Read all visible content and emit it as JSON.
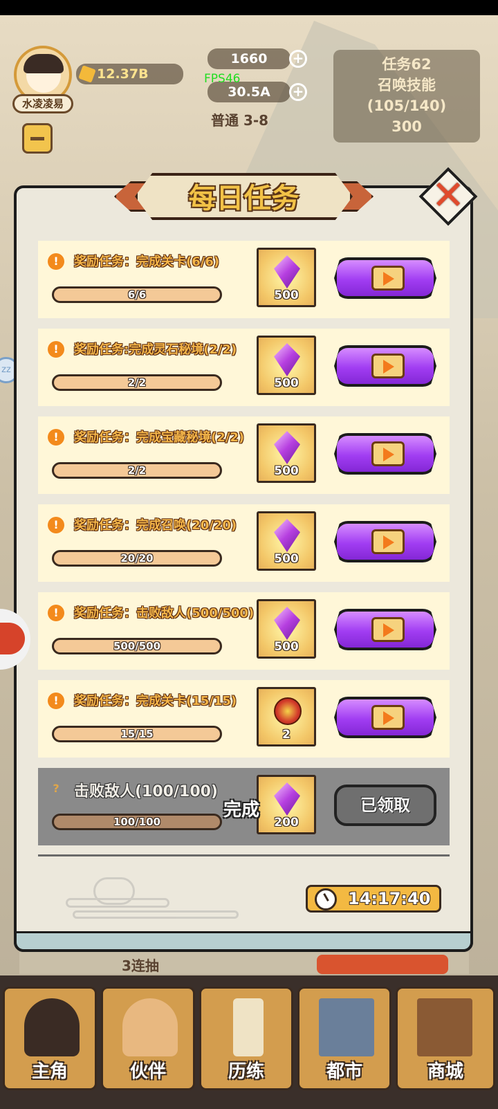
{
  "hud": {
    "player_name": "水凌凌易",
    "gold": "12.37B",
    "gems": "1660",
    "power": "30.5A",
    "fps": "FPS46",
    "stage": "普通 3-8",
    "task_box": {
      "line1": "任务62",
      "line2": "召唤技能",
      "line3": "(105/140)",
      "reward": "300"
    }
  },
  "dialog": {
    "title": "每日任务",
    "close_icon": "close-x-icon",
    "tasks": [
      {
        "title": "奖励任务：完成关卡(6/6)",
        "progress": "6/6",
        "reward_icon": "purple-gem-icon",
        "reward_qty": "500",
        "state": "claim-ad"
      },
      {
        "title": "奖励任务:完成灵石秘境(2/2)",
        "progress": "2/2",
        "reward_icon": "purple-gem-icon",
        "reward_qty": "500",
        "state": "claim-ad"
      },
      {
        "title": "奖励任务：完成宝藏秘境(2/2)",
        "progress": "2/2",
        "reward_icon": "purple-gem-icon",
        "reward_qty": "500",
        "state": "claim-ad"
      },
      {
        "title": "奖励任务：完成召唤(20/20)",
        "progress": "20/20",
        "reward_icon": "purple-gem-icon",
        "reward_qty": "500",
        "state": "claim-ad"
      },
      {
        "title": "奖励任务：击败敌人(500/500)",
        "progress": "500/500",
        "reward_icon": "purple-gem-icon",
        "reward_qty": "500",
        "state": "claim-ad"
      },
      {
        "title": "奖励任务：完成关卡(15/15)",
        "progress": "15/15",
        "reward_icon": "red-coin-icon",
        "reward_qty": "2",
        "state": "claim-ad"
      },
      {
        "title": "击败敌人(100/100)",
        "progress": "100/100",
        "reward_icon": "purple-gem-icon",
        "reward_qty": "200",
        "state": "claimed",
        "done_label": "完成",
        "claimed_label": "已领取"
      }
    ],
    "timer": "14:17:40"
  },
  "peek": {
    "combo": "3连抽"
  },
  "nav": {
    "tabs": [
      {
        "label": "主角"
      },
      {
        "label": "伙伴"
      },
      {
        "label": "历练"
      },
      {
        "label": "都市"
      },
      {
        "label": "商城"
      }
    ]
  },
  "colors": {
    "accent_purple": "#a13df2",
    "gold": "#f3b942",
    "row_bg": "#fff7d8",
    "done_bg": "#8a8a8a"
  }
}
